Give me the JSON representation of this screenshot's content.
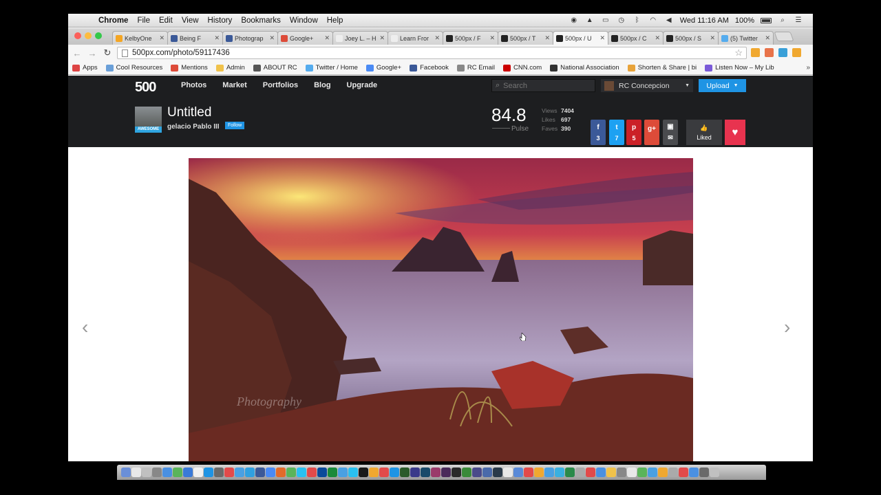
{
  "menubar": {
    "app": "Chrome",
    "items": [
      "File",
      "Edit",
      "View",
      "History",
      "Bookmarks",
      "Window",
      "Help"
    ],
    "clock": "Wed 11:16 AM",
    "battery": "100%"
  },
  "tabs": [
    {
      "label": "KelbyOne",
      "color": "#f5a623"
    },
    {
      "label": "Being F",
      "color": "#3b5998"
    },
    {
      "label": "Photograp",
      "color": "#3b5998"
    },
    {
      "label": "Google+",
      "color": "#dd4b39"
    },
    {
      "label": "Joey L. – H",
      "color": "#eeeeee"
    },
    {
      "label": "Learn Fror",
      "color": "#eeeeee"
    },
    {
      "label": "500px / F",
      "color": "#222222"
    },
    {
      "label": "500px / T",
      "color": "#222222"
    },
    {
      "label": "500px / U",
      "color": "#222222",
      "active": true
    },
    {
      "label": "500px / C",
      "color": "#222222"
    },
    {
      "label": "500px / S",
      "color": "#222222"
    },
    {
      "label": "(5) Twitter",
      "color": "#55acee"
    }
  ],
  "address": {
    "url": "500px.com/photo/59117436"
  },
  "bookmarks": [
    {
      "label": "Apps",
      "color": "#d44"
    },
    {
      "label": "Cool Resources",
      "color": "#6a9fd8"
    },
    {
      "label": "Mentions",
      "color": "#dd4b39"
    },
    {
      "label": "Admin",
      "color": "#f0c24b"
    },
    {
      "label": "ABOUT RC",
      "color": "#555"
    },
    {
      "label": "Twitter / Home",
      "color": "#55acee"
    },
    {
      "label": "Google+",
      "color": "#4a8af4"
    },
    {
      "label": "Facebook",
      "color": "#3b5998"
    },
    {
      "label": "RC Email",
      "color": "#888"
    },
    {
      "label": "CNN.com",
      "color": "#cc0000"
    },
    {
      "label": "National Association",
      "color": "#333"
    },
    {
      "label": "Shorten & Share | bi",
      "color": "#e8a33a"
    },
    {
      "label": "Listen Now – My Lib",
      "color": "#7a5ad8"
    }
  ],
  "site": {
    "logo": "500",
    "nav": [
      "Photos",
      "Market",
      "Portfolios",
      "Blog",
      "Upgrade"
    ],
    "search_placeholder": "Search",
    "user": "RC Concepcion",
    "upload": "Upload"
  },
  "photo": {
    "title": "Untitled",
    "author": "gelacio Pablo III",
    "follow": "Follow",
    "badge": "AWESOME",
    "pulse": "84.8",
    "pulse_label": "Pulse",
    "stats": [
      {
        "label": "Views",
        "value": "7404"
      },
      {
        "label": "Likes",
        "value": "697"
      },
      {
        "label": "Faves",
        "value": "390"
      }
    ],
    "liked": "Liked",
    "watermark": "Photography"
  },
  "share": [
    {
      "name": "facebook",
      "icon": "f",
      "count": "3",
      "color": "#3b5998"
    },
    {
      "name": "twitter",
      "icon": "t",
      "count": "7",
      "color": "#1da1f2"
    },
    {
      "name": "pinterest",
      "icon": "p",
      "count": "5",
      "color": "#cb2027"
    },
    {
      "name": "googleplus",
      "icon": "g+",
      "count": "",
      "color": "#dd4b39"
    },
    {
      "name": "embed",
      "icon": "▣",
      "count": "✉",
      "color": "#4a4b4e"
    }
  ]
}
